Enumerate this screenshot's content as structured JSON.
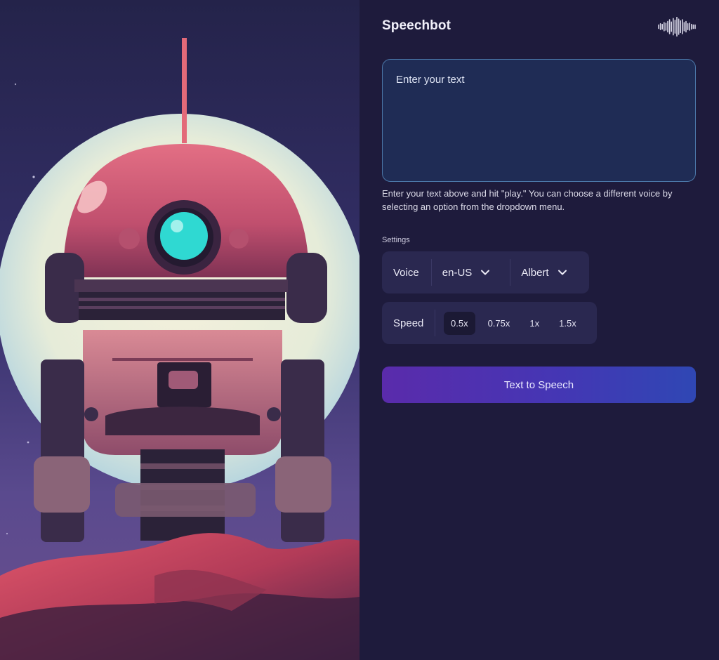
{
  "app": {
    "title": "Speechbot"
  },
  "icons": {
    "header": "sound-wave-icon",
    "dropdown": "chevron-down-icon"
  },
  "artwork": {
    "subject": "robot-illustration"
  },
  "input": {
    "placeholder": "Enter your text"
  },
  "helper_text": "Enter your text above and hit \"play.\" You can choose a different voice by selecting an option from the dropdown menu.",
  "settings": {
    "label": "Settings",
    "voice": {
      "label": "Voice",
      "locale": "en-US",
      "name": "Albert"
    },
    "speed": {
      "label": "Speed",
      "options": [
        "0.5x",
        "0.75x",
        "1x",
        "1.5x"
      ],
      "selected": "0.5x"
    }
  },
  "action": {
    "label": "Text to Speech"
  },
  "colors": {
    "panel_bg": "#1e1b3c",
    "input_bg": "#1f2c55",
    "input_border": "#4b77a8",
    "button_start": "#5a2bab",
    "button_end": "#2f47b4"
  }
}
